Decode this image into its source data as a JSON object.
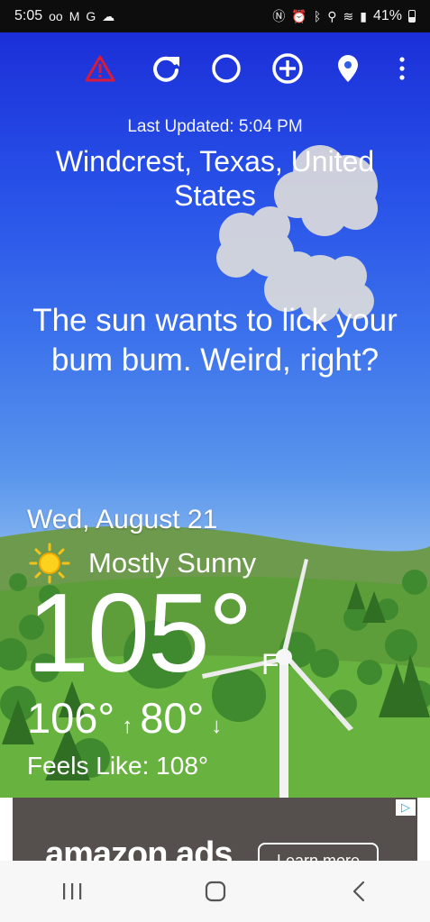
{
  "status_bar": {
    "time": "5:05",
    "battery": "41%"
  },
  "toolbar": {
    "icons": [
      "warning-icon",
      "refresh-icon",
      "theme-icon",
      "add-location-icon",
      "location-pin-icon",
      "more-icon"
    ]
  },
  "weather": {
    "last_updated": "Last Updated: 5:04 PM",
    "location": "Windcrest, Texas, United States",
    "quip": "The sun wants to lick your bum bum. Weird, right?",
    "date": "Wed, August 21",
    "condition": "Mostly Sunny",
    "temperature": "105°",
    "unit": "F",
    "high": "106°",
    "low": "80°",
    "high_arrow": "↑",
    "low_arrow": "↓",
    "feels_like": "Feels Like:  108°"
  },
  "ad": {
    "brand": "amazon ads",
    "cta": "Learn more"
  },
  "colors": {
    "warning": "#d81b3a",
    "sky_top": "#1b2fd8",
    "grass": "#5e9e3a"
  }
}
